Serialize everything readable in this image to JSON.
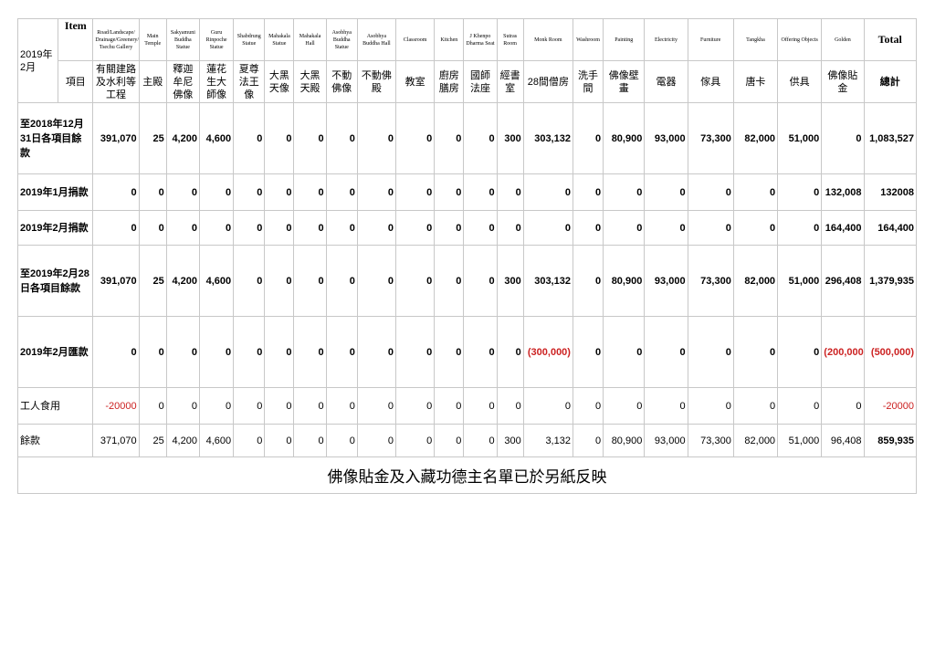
{
  "corner_label": "2019年2月",
  "header": {
    "item_en": "Item",
    "item_zh": "項目",
    "columns": [
      {
        "en": "Road/Landscape/ Drainage/Greenery/ Tsechu Gallery",
        "zh": "有關建路及水利等工程"
      },
      {
        "en": "Main Temple",
        "zh": "主殿"
      },
      {
        "en": "Sakyamuni Buddha Statue",
        "zh": "釋迦牟尼佛像"
      },
      {
        "en": "Guru Rinpoche Statue",
        "zh": "蓮花生大師像"
      },
      {
        "en": "Shabdrung Statue",
        "zh": "夏尊法王像"
      },
      {
        "en": "Mahakala Statue",
        "zh": "大黑天像"
      },
      {
        "en": "Mahakala Hall",
        "zh": "大黑天殿"
      },
      {
        "en": "Asobhya Buddha Statue",
        "zh": "不動佛像"
      },
      {
        "en": "Asobhya Buddha Hall",
        "zh": "不動佛殿"
      },
      {
        "en": "Classroom",
        "zh": "教室"
      },
      {
        "en": "Kitchen",
        "zh": "廚房膳房"
      },
      {
        "en": "J Khenpo Dharma Seat",
        "zh": "國師法座"
      },
      {
        "en": "Sutras Room",
        "zh": "經書室"
      },
      {
        "en": "Monk Room",
        "zh": "28間僧房"
      },
      {
        "en": "Washroom",
        "zh": "洗手間"
      },
      {
        "en": "Painting",
        "zh": "佛像壁畫"
      },
      {
        "en": "Electricity",
        "zh": "電器"
      },
      {
        "en": "Furniture",
        "zh": "傢具"
      },
      {
        "en": "Tangkha",
        "zh": "唐卡"
      },
      {
        "en": "Offering Objects",
        "zh": "供具"
      },
      {
        "en": "Golden",
        "zh": "佛像貼金"
      }
    ],
    "total_en": "Total",
    "total_zh": "總計"
  },
  "rows": [
    {
      "label": "至2018年12月31日各項目餘款",
      "values": [
        "391,070",
        "25",
        "4,200",
        "4,600",
        "0",
        "0",
        "0",
        "0",
        "0",
        "0",
        "0",
        "0",
        "300",
        "303,132",
        "0",
        "80,900",
        "93,000",
        "73,300",
        "82,000",
        "51,000",
        "0"
      ],
      "total": "1,083,527"
    },
    {
      "label": "2019年1月捐款",
      "values": [
        "0",
        "0",
        "0",
        "0",
        "0",
        "0",
        "0",
        "0",
        "0",
        "0",
        "0",
        "0",
        "0",
        "0",
        "0",
        "0",
        "0",
        "0",
        "0",
        "0",
        "132,008"
      ],
      "total": "132008"
    },
    {
      "label": "2019年2月捐款",
      "values": [
        "0",
        "0",
        "0",
        "0",
        "0",
        "0",
        "0",
        "0",
        "0",
        "0",
        "0",
        "0",
        "0",
        "0",
        "0",
        "0",
        "0",
        "0",
        "0",
        "0",
        "164,400"
      ],
      "total": "164,400"
    },
    {
      "label": "至2019年2月28日各項目餘款",
      "values": [
        "391,070",
        "25",
        "4,200",
        "4,600",
        "0",
        "0",
        "0",
        "0",
        "0",
        "0",
        "0",
        "0",
        "300",
        "303,132",
        "0",
        "80,900",
        "93,000",
        "73,300",
        "82,000",
        "51,000",
        "296,408"
      ],
      "total": "1,379,935"
    },
    {
      "label": "2019年2月匯款",
      "values": [
        "0",
        "0",
        "0",
        "0",
        "0",
        "0",
        "0",
        "0",
        "0",
        "0",
        "0",
        "0",
        "0",
        "(300,000)",
        "0",
        "0",
        "0",
        "0",
        "0",
        "0",
        "(200,000)"
      ],
      "total": "(500,000)"
    },
    {
      "label": "工人食用",
      "values": [
        "-20000",
        "0",
        "0",
        "0",
        "0",
        "0",
        "0",
        "0",
        "0",
        "0",
        "0",
        "0",
        "0",
        "0",
        "0",
        "0",
        "0",
        "0",
        "0",
        "0",
        "0"
      ],
      "total": "-20000"
    },
    {
      "label": "餘款",
      "values": [
        "371,070",
        "25",
        "4,200",
        "4,600",
        "0",
        "0",
        "0",
        "0",
        "0",
        "0",
        "0",
        "0",
        "300",
        "3,132",
        "0",
        "80,900",
        "93,000",
        "73,300",
        "82,000",
        "51,000",
        "96,408"
      ],
      "total": "859,935"
    }
  ],
  "note": "佛像貼金及入藏功德主名單已於另紙反映",
  "colors": {
    "grid": "#c8c8c8",
    "negative": "#cc2222"
  }
}
